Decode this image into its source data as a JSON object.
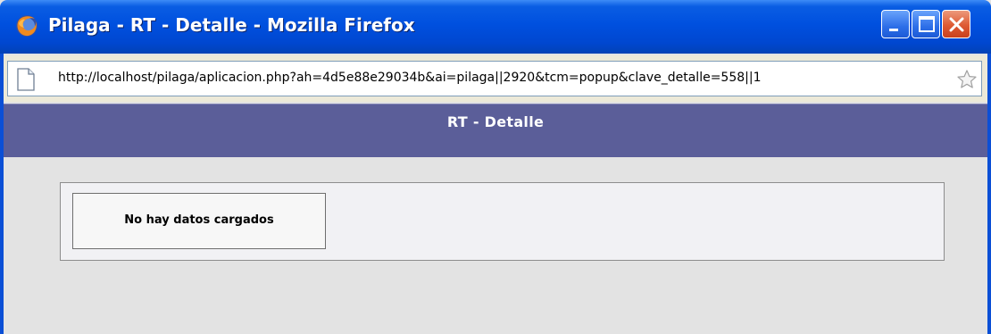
{
  "window": {
    "title": "Pilaga - RT - Detalle - Mozilla Firefox",
    "icon": "firefox-icon",
    "controls": [
      "minimize-icon",
      "maximize-icon",
      "close-icon"
    ]
  },
  "address_bar": {
    "url": "http://localhost/pilaga/aplicacion.php?ah=4d5e88e29034b&ai=pilaga||2920&tcm=popup&clave_detalle=558||1",
    "page_icon": "page-icon",
    "bookmark_icon": "star-icon"
  },
  "page": {
    "header_title": "RT - Detalle",
    "message": "No hay datos cargados"
  },
  "colors": {
    "titlebar": "#0050df",
    "header_band": "#5b5e99",
    "page_background": "#e3e3e3"
  }
}
